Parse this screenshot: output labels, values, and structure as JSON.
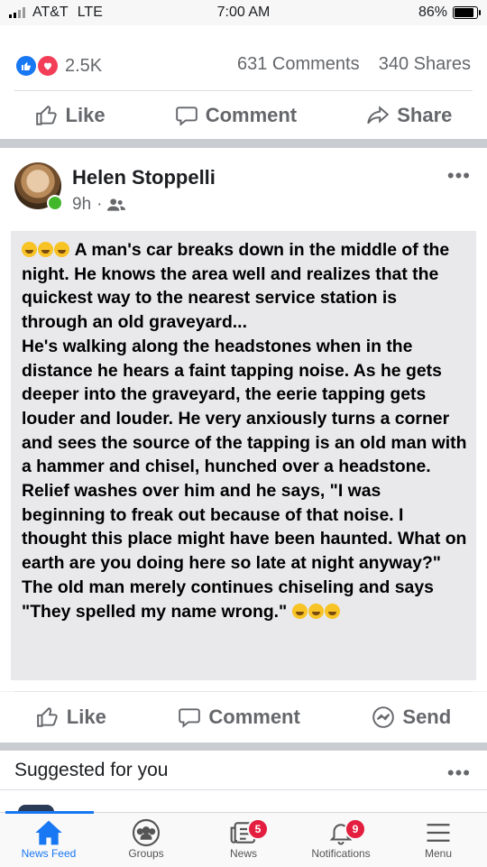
{
  "status_bar": {
    "carrier": "AT&T",
    "network": "LTE",
    "time": "7:00 AM",
    "battery": "86%",
    "battery_level": 0.86
  },
  "prev_post": {
    "reactions_count": "2.5K",
    "comments": "631 Comments",
    "shares": "340 Shares",
    "actions": {
      "like": "Like",
      "comment": "Comment",
      "share": "Share"
    }
  },
  "post": {
    "author": "Helen Stoppelli",
    "time": "9h",
    "audience_icon": "friends-icon",
    "more_icon": "more-dots-icon",
    "paragraphs": [
      "A man's car breaks down in the middle of the night. He knows the area well and realizes that the quickest way to the nearest service station is through an old graveyard...",
      "He's walking along the headstones when in the distance he hears a faint tapping noise. As he gets deeper into the graveyard, the eerie tapping gets louder and louder. He very anxiously turns a corner and sees the source of the tapping is an old man with a hammer and chisel, hunched over a headstone.",
      "Relief washes over him and he says, \"I was beginning to freak out because of that noise. I thought this place might have been haunted. What on earth are you doing here so late at night anyway?\"",
      "The old man merely continues chiseling and says \"They spelled my name wrong.\""
    ],
    "actions": {
      "like": "Like",
      "comment": "Comment",
      "send": "Send"
    }
  },
  "suggested": {
    "title": "Suggested for you"
  },
  "tabs": [
    {
      "label": "News Feed",
      "icon": "home-icon",
      "active": true
    },
    {
      "label": "Groups",
      "icon": "groups-icon"
    },
    {
      "label": "News",
      "icon": "news-icon",
      "badge": "5"
    },
    {
      "label": "Notifications",
      "icon": "bell-icon",
      "badge": "9"
    },
    {
      "label": "Menu",
      "icon": "menu-icon"
    }
  ],
  "colors": {
    "accent": "#1877f2",
    "badge": "#e41e3f",
    "love": "#f33e58"
  }
}
